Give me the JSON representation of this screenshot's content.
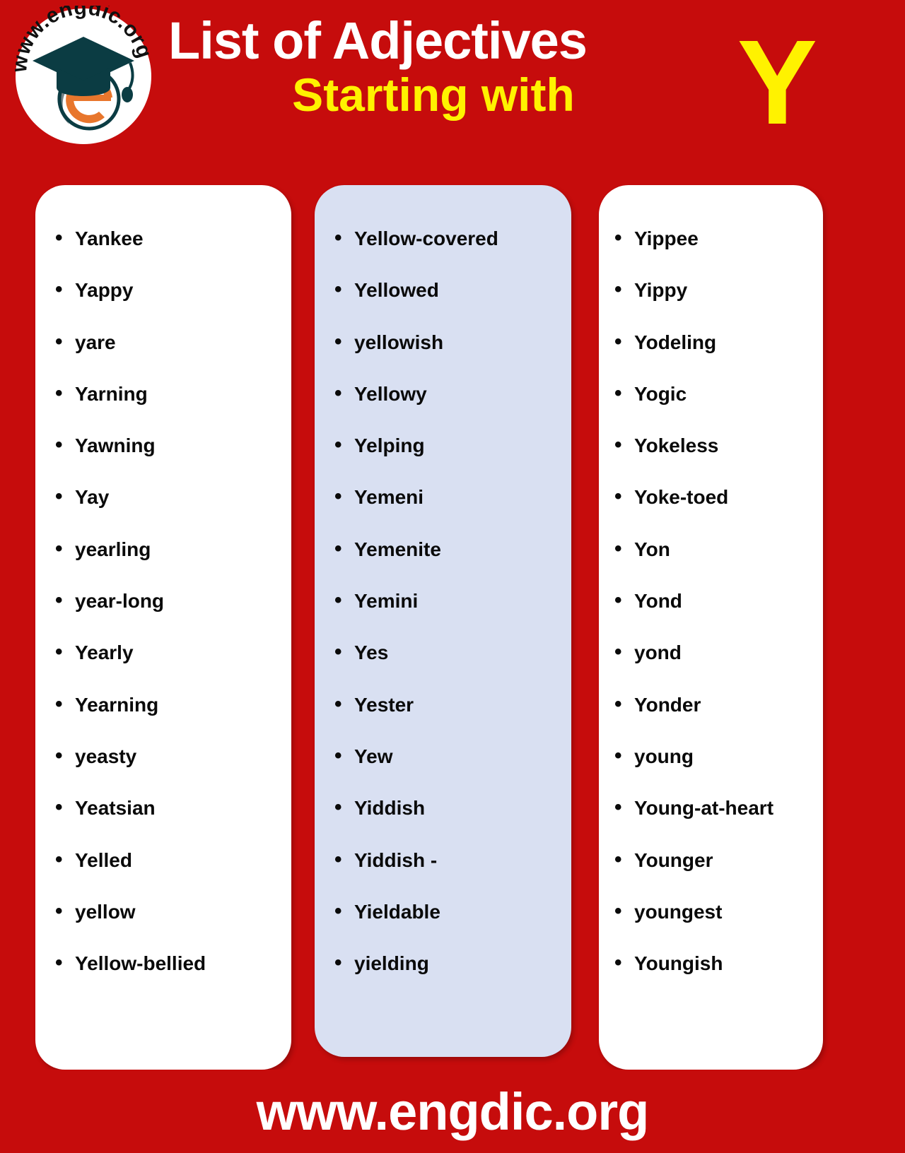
{
  "theme": {
    "background_red": "#C60C0C",
    "accent_yellow": "#FFF200",
    "card_white": "#FFFFFF",
    "card_blue": "#D9E0F2",
    "text_black": "#0A0A0A",
    "logo_teal": "#0B3C43",
    "logo_orange": "#E8762C"
  },
  "header": {
    "logo": {
      "name": "engdic-logo",
      "circle_text": "www.engdic.org",
      "icon": "graduation-cap-with-letter-e"
    },
    "title_line1": "List of Adjectives",
    "title_line2": "Starting with",
    "letter": "Y"
  },
  "columns": [
    {
      "id": "column-1",
      "background": "#FFFFFF",
      "items": [
        "Yankee",
        "Yappy",
        "yare",
        "Yarning",
        "Yawning",
        "Yay",
        "yearling",
        "year-long",
        "Yearly",
        "Yearning",
        "yeasty",
        "Yeatsian",
        "Yelled",
        "yellow",
        "Yellow-bellied"
      ]
    },
    {
      "id": "column-2",
      "background": "#D9E0F2",
      "items": [
        "Yellow-covered",
        "Yellowed",
        "yellowish",
        "Yellowy",
        "Yelping",
        "Yemeni",
        "Yemenite",
        "Yemini",
        "Yes",
        "Yester",
        "Yew",
        "Yiddish",
        "Yiddish -",
        "Yieldable",
        "yielding"
      ]
    },
    {
      "id": "column-3",
      "background": "#FFFFFF",
      "items": [
        "Yippee",
        "Yippy",
        "Yodeling",
        "Yogic",
        "Yokeless",
        "Yoke-toed",
        "Yon",
        "Yond",
        "yond",
        "Yonder",
        "young",
        "Young-at-heart",
        "Younger",
        "youngest",
        "Youngish"
      ]
    }
  ],
  "footer": {
    "website": "www.engdic.org"
  }
}
